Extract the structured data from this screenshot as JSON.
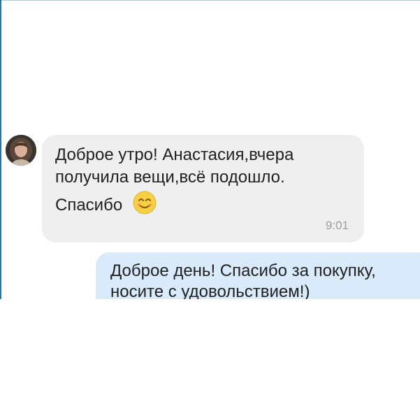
{
  "incoming_message": {
    "line1": "Доброе утро! Анастасия,вчера",
    "line2": "получила вещи,всё подошло.",
    "line3": "Спасибо",
    "emoji": "smiling-face-icon",
    "time": "9:01"
  },
  "outgoing_message": {
    "line1": "Доброе день! Спасибо за покупку,",
    "line2": "носите с удовольствием!)"
  },
  "colors": {
    "incoming_bubble": "#efefef",
    "outgoing_bubble": "#d9ebfb",
    "text": "#212121",
    "time": "#9e9e9e",
    "emoji_face": "#f7cf45"
  }
}
